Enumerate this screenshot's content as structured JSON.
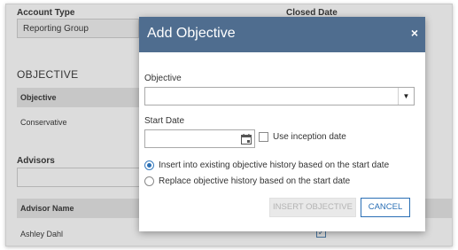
{
  "background": {
    "account_type_label": "Account Type",
    "account_type_value": "Reporting Group",
    "closed_date_label": "Closed Date",
    "objective_heading": "OBJECTIVE",
    "objective_column": "Objective",
    "objective_value": "Conservative",
    "advisors_label": "Advisors",
    "advisor_name_column": "Advisor Name",
    "advisor_name_value": "Ashley Dahl",
    "advisor_check": "✓"
  },
  "dialog": {
    "title": "Add Objective",
    "close_glyph": "×",
    "objective_label": "Objective",
    "objective_value": "",
    "select_arrow": "▼",
    "start_date_label": "Start Date",
    "start_date_value": "",
    "use_inception_label": "Use inception date",
    "use_inception_checked": false,
    "radio_options": [
      {
        "label": "Insert into existing objective history based on the start date",
        "selected": true
      },
      {
        "label": "Replace objective history based on the start date",
        "selected": false
      }
    ],
    "insert_button": "INSERT OBJECTIVE",
    "cancel_button": "CANCEL"
  },
  "colors": {
    "header_bg": "#4f6d8f",
    "accent": "#2a6fb5",
    "disabled_text": "#b3b3b3"
  },
  "icons": {
    "calendar": "calendar-icon",
    "close": "close-icon",
    "dropdown": "chevron-down-icon"
  }
}
